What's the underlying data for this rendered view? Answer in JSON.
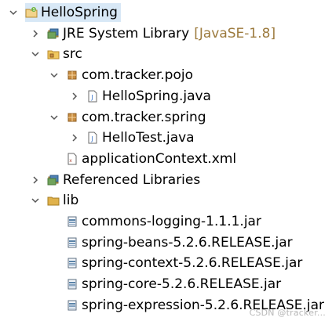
{
  "tree": {
    "items": [
      {
        "label": "HelloSpring",
        "decoration": "",
        "icon": "spring-project-icon",
        "toggle": "expanded",
        "level": 0,
        "selected": true
      },
      {
        "label": "JRE System Library",
        "decoration": "[JavaSE-1.8]",
        "icon": "library-icon",
        "toggle": "collapsed",
        "level": 1,
        "selected": false
      },
      {
        "label": "src",
        "decoration": "",
        "icon": "source-folder-icon",
        "toggle": "expanded",
        "level": 1,
        "selected": false
      },
      {
        "label": "com.tracker.pojo",
        "decoration": "",
        "icon": "package-icon",
        "toggle": "expanded",
        "level": 2,
        "selected": false
      },
      {
        "label": "HelloSpring.java",
        "decoration": "",
        "icon": "java-file-icon",
        "toggle": "collapsed",
        "level": 3,
        "selected": false
      },
      {
        "label": "com.tracker.spring",
        "decoration": "",
        "icon": "package-icon",
        "toggle": "expanded",
        "level": 2,
        "selected": false
      },
      {
        "label": "HelloTest.java",
        "decoration": "",
        "icon": "java-file-icon",
        "toggle": "collapsed",
        "level": 3,
        "selected": false
      },
      {
        "label": "applicationContext.xml",
        "decoration": "",
        "icon": "xml-file-icon",
        "toggle": "none",
        "level": 2,
        "selected": false
      },
      {
        "label": "Referenced Libraries",
        "decoration": "",
        "icon": "library-icon",
        "toggle": "collapsed",
        "level": 1,
        "selected": false
      },
      {
        "label": "lib",
        "decoration": "",
        "icon": "folder-icon",
        "toggle": "expanded",
        "level": 1,
        "selected": false
      },
      {
        "label": "commons-logging-1.1.1.jar",
        "decoration": "",
        "icon": "jar-file-icon",
        "toggle": "none",
        "level": 2,
        "selected": false
      },
      {
        "label": "spring-beans-5.2.6.RELEASE.jar",
        "decoration": "",
        "icon": "jar-file-icon",
        "toggle": "none",
        "level": 2,
        "selected": false
      },
      {
        "label": "spring-context-5.2.6.RELEASE.jar",
        "decoration": "",
        "icon": "jar-file-icon",
        "toggle": "none",
        "level": 2,
        "selected": false
      },
      {
        "label": "spring-core-5.2.6.RELEASE.jar",
        "decoration": "",
        "icon": "jar-file-icon",
        "toggle": "none",
        "level": 2,
        "selected": false
      },
      {
        "label": "spring-expression-5.2.6.RELEASE.jar",
        "decoration": "",
        "icon": "jar-file-icon",
        "toggle": "none",
        "level": 2,
        "selected": false
      }
    ]
  },
  "colors": {
    "selection": "#d8e8f6",
    "decoration": "#9c7a3d",
    "package": "#c98e42",
    "folder": "#e0b24b",
    "java": "#3a74c9",
    "jar": "#5a83a8",
    "spring": "#6db33f"
  },
  "watermark": "CSDN @tracker..."
}
